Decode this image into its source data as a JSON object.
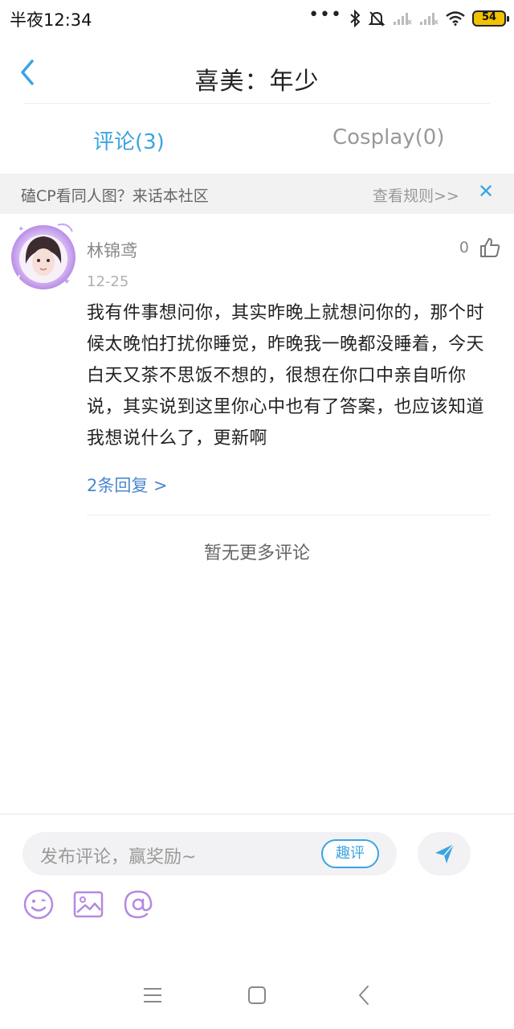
{
  "status_bar": {
    "time": "半夜12:34",
    "battery": "54",
    "icons": [
      "more-dots-icon",
      "bluetooth-icon",
      "bell-off-icon",
      "signal-icon",
      "signal-icon",
      "wifi-icon",
      "battery-icon"
    ]
  },
  "header": {
    "title": "喜美：年少",
    "back_icon": "chevron-left-icon"
  },
  "tabs": [
    {
      "label": "评论(3)",
      "active": true
    },
    {
      "label": "Cosplay(0)",
      "active": false
    }
  ],
  "notice": {
    "text": "磕CP看同人图？来话本社区",
    "link": "查看规则>>",
    "close": "✕"
  },
  "comment": {
    "username": "林锦鸢",
    "date": "12-25",
    "likes": "0",
    "body": "我有件事想问你，其实昨晚上就想问你的，那个时候太晚怕打扰你睡觉，昨晚我一晚都没睡着，今天白天又茶不思饭不想的，很想在你口中亲自听你说，其实说到这里你心中也有了答案，也应该知道我想说什么了，更新啊",
    "replies": "2条回复 >"
  },
  "no_more": "暂无更多评论",
  "composer": {
    "placeholder": "发布评论，赢奖励~",
    "quick_label": "趣评",
    "tools": [
      "emoji-icon",
      "image-icon",
      "mention-icon"
    ]
  },
  "colors": {
    "accent": "#3ba4e0",
    "link": "#4b88cf",
    "tool_purple": "#b48ae0"
  }
}
